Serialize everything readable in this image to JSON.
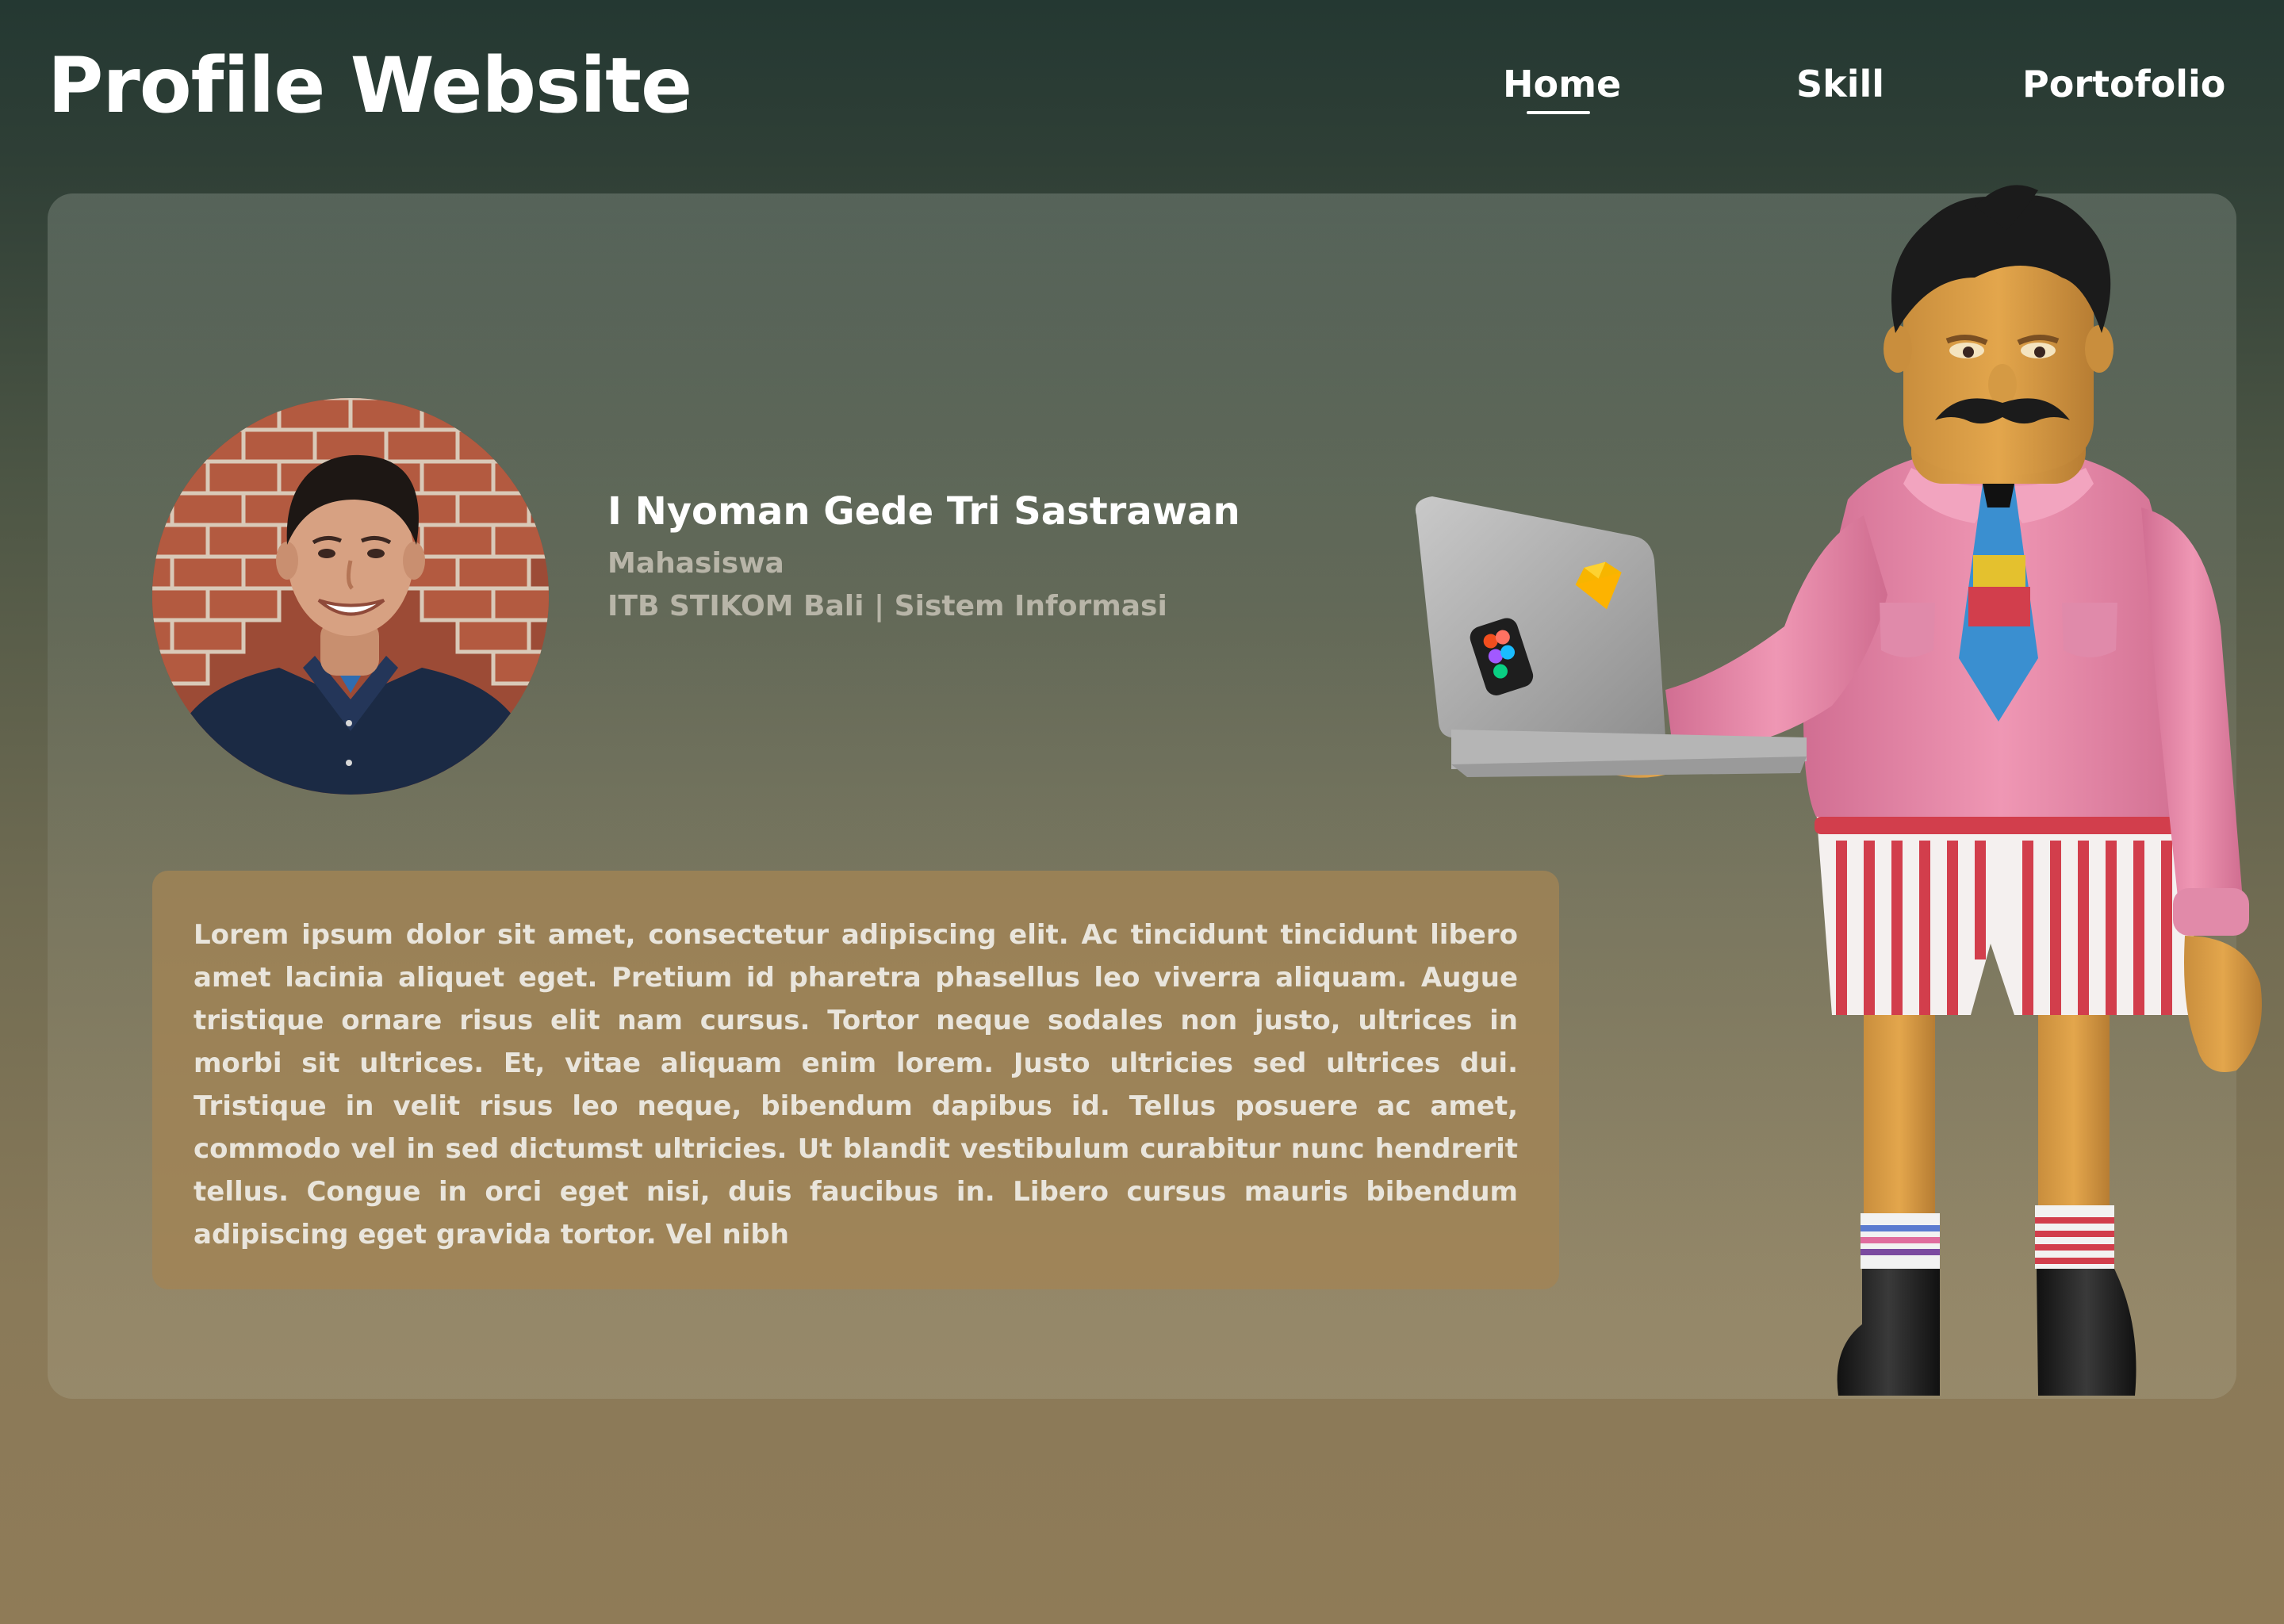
{
  "header": {
    "site_title": "Profile Website",
    "nav": [
      {
        "label": "Home",
        "active": true
      },
      {
        "label": "Skill",
        "active": false
      },
      {
        "label": "Portofolio",
        "active": false
      }
    ]
  },
  "profile": {
    "name": "I Nyoman Gede Tri Sastrawan",
    "role": "Mahasiswa",
    "organization": "ITB STIKOM Bali | Sistem Informasi",
    "avatar_icon": "profile-photo",
    "description": "Lorem ipsum dolor sit amet, consectetur adipiscing elit. Ac tincidunt tincidunt libero amet lacinia aliquet eget. Pretium id pharetra phasellus leo viverra aliquam. Augue tristique ornare risus elit nam cursus. Tortor neque sodales non justo, ultrices in morbi sit ultrices. Et, vitae aliquam enim lorem. Justo ultricies sed ultrices dui. Tristique in velit risus leo neque, bibendum dapibus id. Tellus posuere ac amet, commodo vel in sed dictumst ultricies. Ut blandit vestibulum curabitur nunc hendrerit tellus. Congue in orci eget nisi, duis faucibus in. Libero cursus mauris bibendum adipiscing eget gravida tortor. Vel nibh"
  },
  "illustration": {
    "icon": "3d-character-with-laptop"
  },
  "colors": {
    "background_top": "#243832",
    "background_bottom": "#8f7b57",
    "description_box": "#a38455",
    "muted_text": "#b8b5a8"
  }
}
